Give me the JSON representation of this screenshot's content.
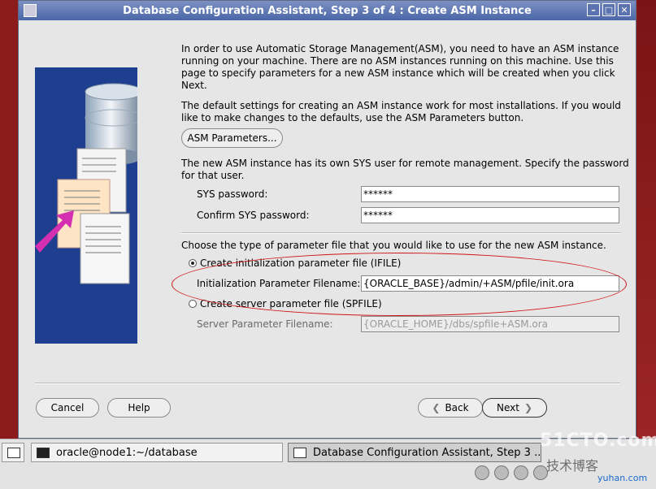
{
  "window": {
    "title": "Database Configuration Assistant, Step 3 of 4 : Create ASM Instance",
    "min": "–",
    "max": "□",
    "close": "✕"
  },
  "intro": [
    "In order to use Automatic Storage Management(ASM), you need to have an ASM instance",
    "running on your machine. There are no ASM instances running on this machine. Use this",
    "page to specify parameters for a new ASM instance which will be created when you click",
    "Next."
  ],
  "defaults": [
    "The default settings for creating an ASM instance work for most installations. If you would",
    "like to make changes to the defaults, use the ASM Parameters button."
  ],
  "asm_params_button": "ASM Parameters...",
  "sys_user_text": [
    "The new ASM instance has its own SYS user for remote management. Specify the password",
    "for that user."
  ],
  "sys_password": {
    "label": "SYS password:",
    "value": "******"
  },
  "confirm_password": {
    "label": "Confirm SYS password:",
    "value": "******"
  },
  "param_file_text": "Choose the type of parameter file that you would like to use for the new ASM instance.",
  "ifile": {
    "option": "Create initialization parameter file (IFILE)",
    "label": "Initialization Parameter Filename:",
    "value": "{ORACLE_BASE}/admin/+ASM/pfile/init.ora"
  },
  "spfile": {
    "option": "Create server parameter file (SPFILE)",
    "label": "Server Parameter Filename:",
    "value": "{ORACLE_HOME}/dbs/spfile+ASM.ora"
  },
  "buttons": {
    "cancel": "Cancel",
    "help": "Help",
    "back": "Back",
    "next": "Next",
    "back_arrow": "❮",
    "next_arrow": "❯"
  },
  "taskbar": {
    "terminal": "oracle@node1:~/database",
    "dbca": "Database Configuration Assistant, Step 3 ..."
  },
  "watermark": {
    "main": "51CTO.com",
    "sub": "技术博客",
    "site": "yuhan.com"
  }
}
